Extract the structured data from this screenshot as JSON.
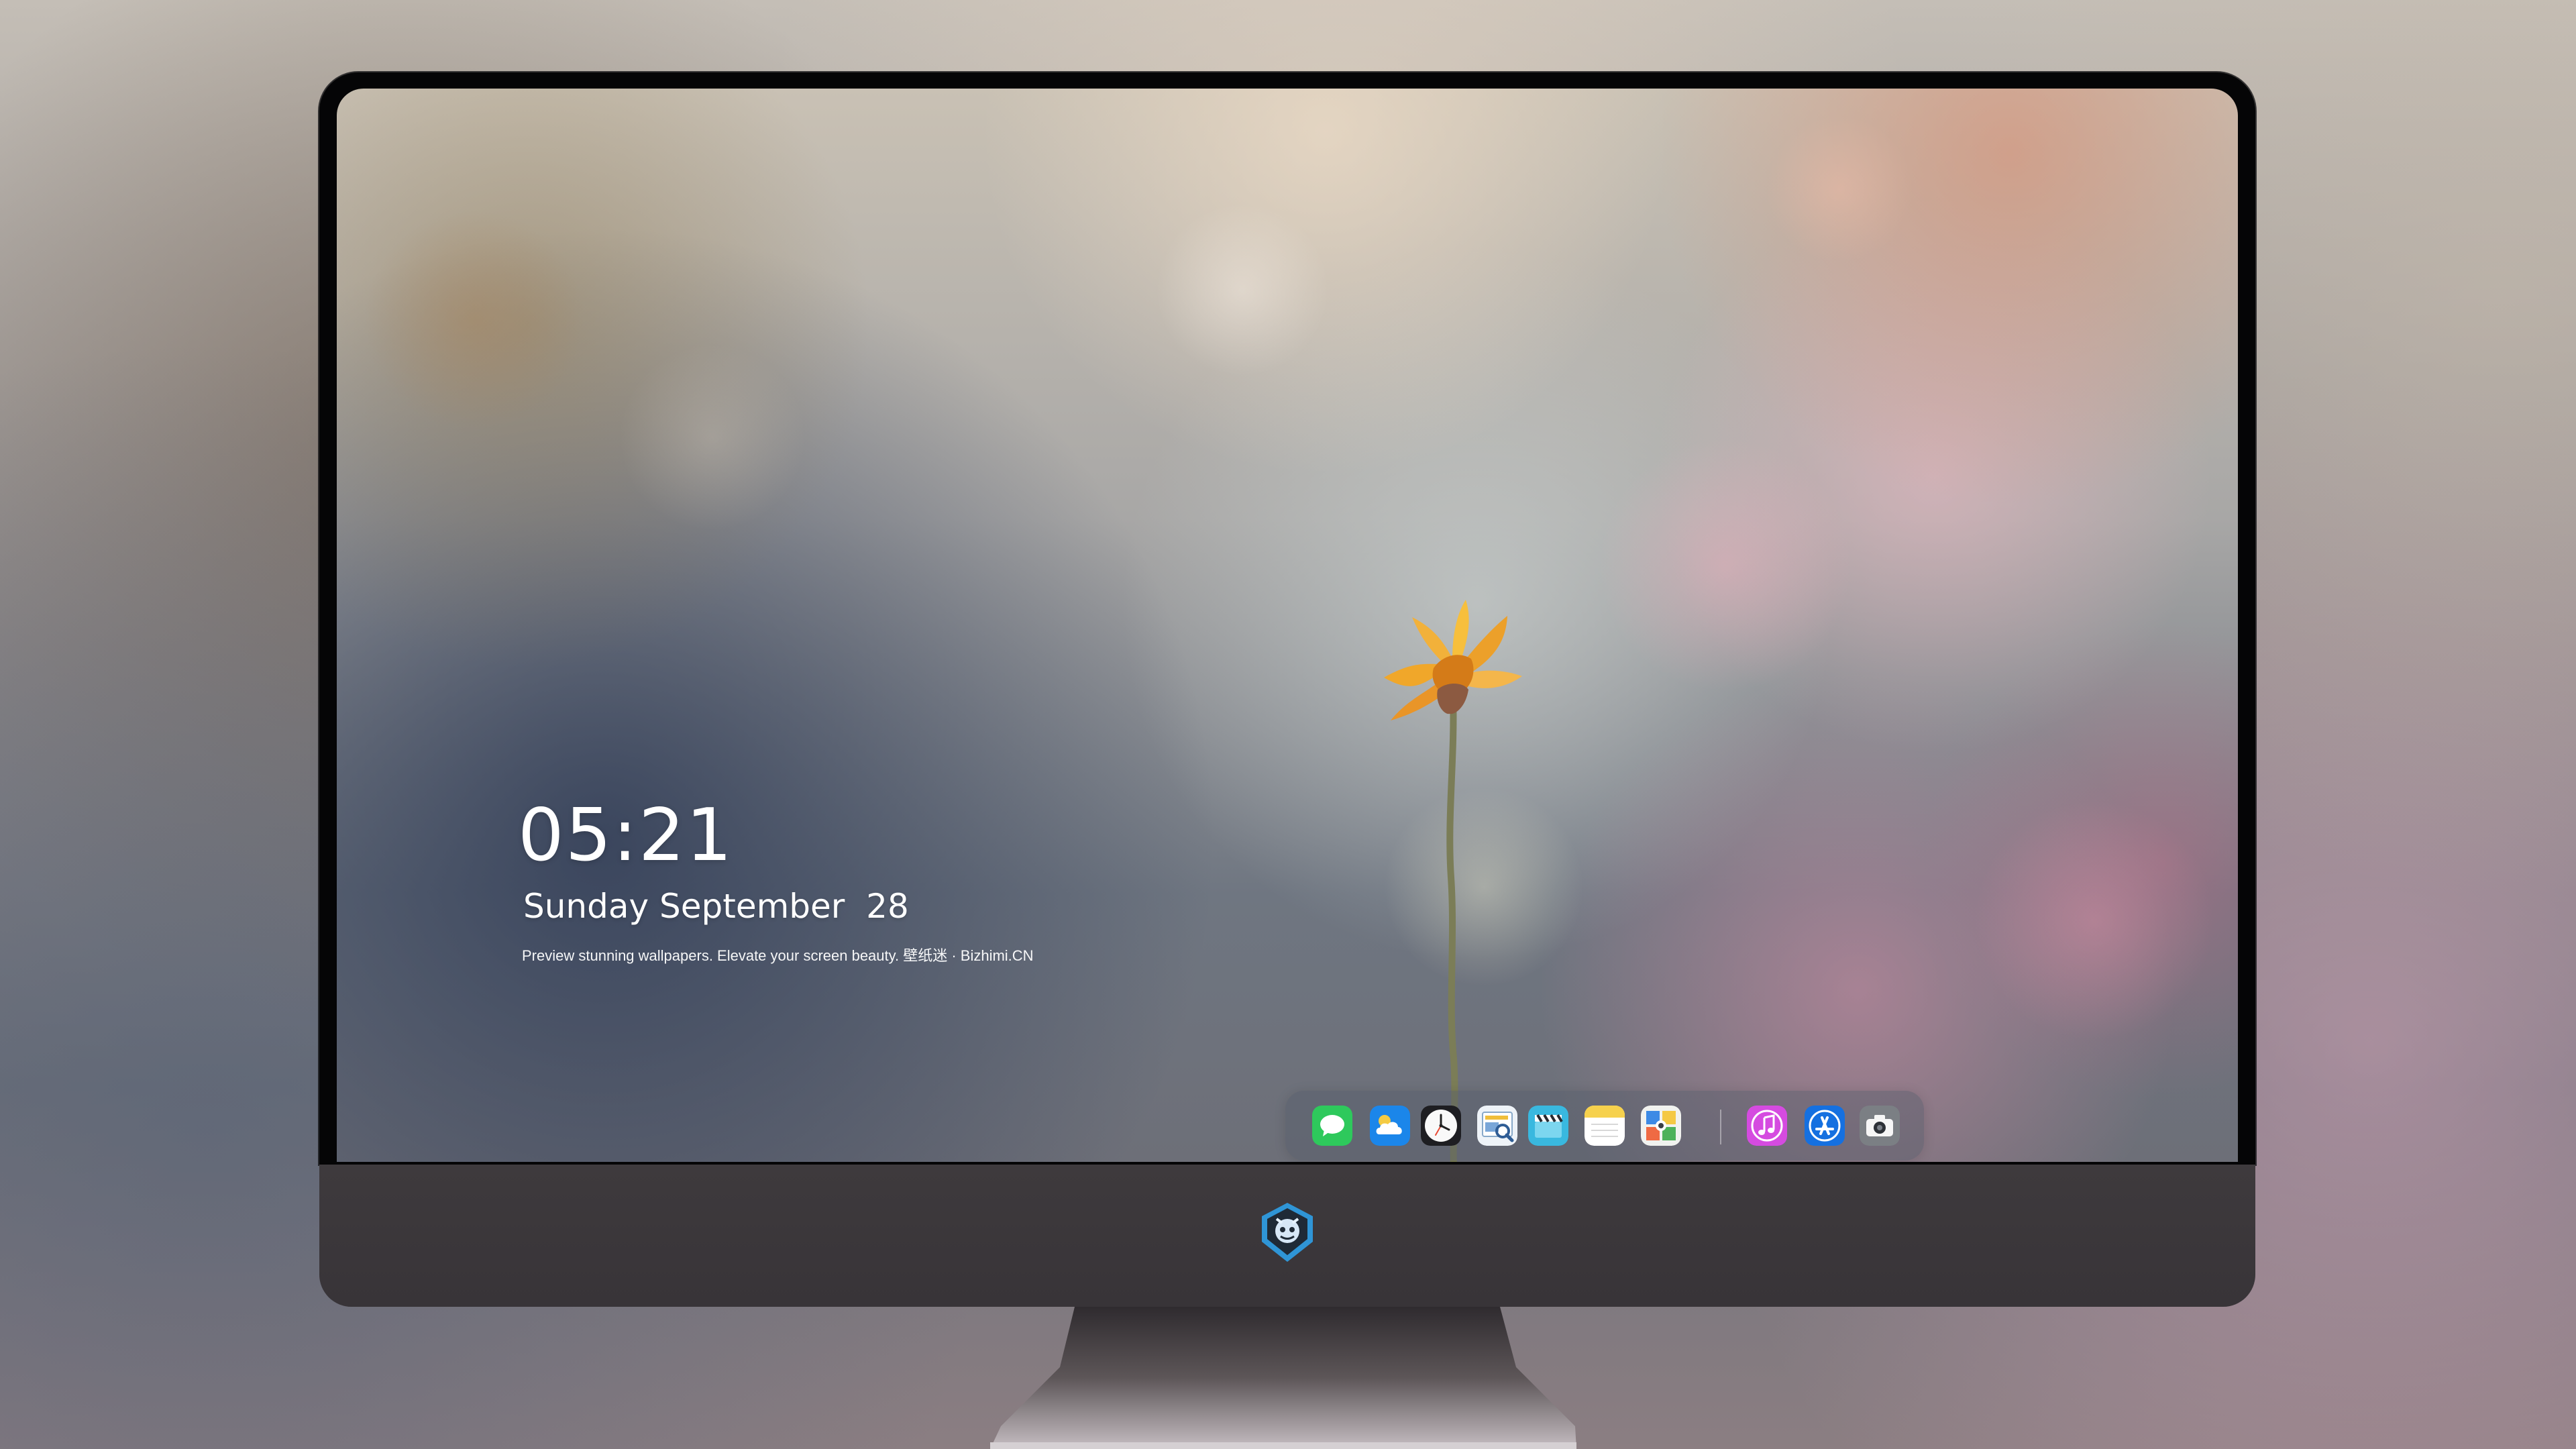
{
  "lock_screen": {
    "time": "05:21",
    "date": "Sunday September  28",
    "tagline": "Preview stunning wallpapers. Elevate your screen beauty. 壁纸迷 · Bizhimi.CN"
  },
  "dock": {
    "apps": [
      {
        "name": "messages",
        "icon": "message-bubble-icon"
      },
      {
        "name": "weather",
        "icon": "weather-cloud-icon"
      },
      {
        "name": "clock",
        "icon": "clock-icon"
      },
      {
        "name": "preview",
        "icon": "preview-magnifier-icon"
      },
      {
        "name": "video",
        "icon": "clapperboard-icon"
      },
      {
        "name": "notes",
        "icon": "notes-icon"
      },
      {
        "name": "photo-booth",
        "icon": "photo-grid-icon"
      },
      {
        "name": "music",
        "icon": "music-note-icon"
      },
      {
        "name": "app-store",
        "icon": "app-store-icon"
      },
      {
        "name": "camera",
        "icon": "camera-icon"
      }
    ]
  },
  "brand": {
    "chin_logo": "robot-shield-logo"
  },
  "colors": {
    "messages": "#2ec95c",
    "weather": "#1b86ea",
    "notes": "#f6d14d",
    "music": "#d54be0",
    "app_store": "#1570e0"
  }
}
